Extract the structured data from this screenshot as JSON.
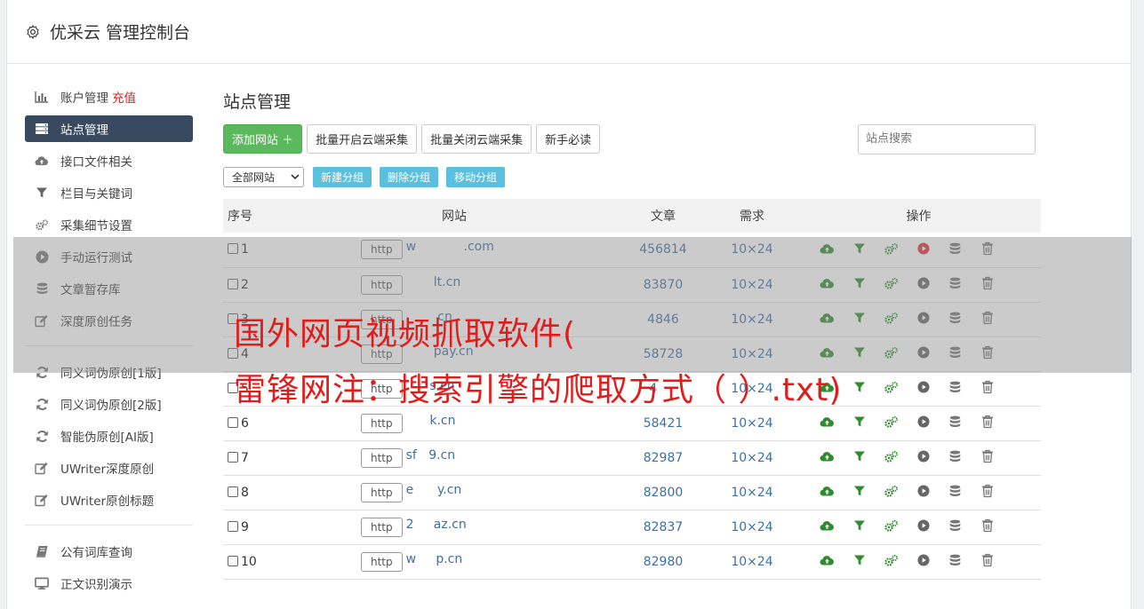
{
  "app": {
    "title": "优采云 管理控制台"
  },
  "sidebar": {
    "items": [
      {
        "label": "账户管理",
        "extra": "充值",
        "icon": "bar-chart-icon"
      },
      {
        "label": "站点管理",
        "icon": "server-icon",
        "active": true
      },
      {
        "label": "接口文件相关",
        "icon": "cloud-upload-icon"
      },
      {
        "label": "栏目与关键词",
        "icon": "filter-icon"
      },
      {
        "label": "采集细节设置",
        "icon": "gears-icon"
      },
      {
        "label": "手动运行测试",
        "icon": "play-circle-icon"
      },
      {
        "label": "文章暂存库",
        "icon": "database-icon"
      },
      {
        "label": "深度原创任务",
        "icon": "edit-icon"
      },
      {
        "label": "同义词伪原创[1版]",
        "icon": "refresh-icon"
      },
      {
        "label": "同义词伪原创[2版]",
        "icon": "refresh-icon"
      },
      {
        "label": "智能伪原创[AI版]",
        "icon": "refresh-icon"
      },
      {
        "label": "UWriter深度原创",
        "icon": "edit-icon"
      },
      {
        "label": "UWriter原创标题",
        "icon": "edit-icon"
      },
      {
        "label": "公有词库查询",
        "icon": "book-icon"
      },
      {
        "label": "正文识别演示",
        "icon": "monitor-icon"
      }
    ]
  },
  "main": {
    "title": "站点管理",
    "toolbar": {
      "add_site": "添加网站 ＋",
      "batch_open": "批量开启云端采集",
      "batch_close": "批量关闭云端采集",
      "newbie": "新手必读",
      "search_placeholder": "站点搜索"
    },
    "filter": {
      "select_value": "全部网站",
      "new_group": "新建分组",
      "delete_group": "删除分组",
      "move_group": "移动分组"
    },
    "table": {
      "headers": {
        "idx": "序号",
        "site": "网站",
        "articles": "文章",
        "demand": "需求",
        "ops": "操作"
      },
      "rows": [
        {
          "idx": "1",
          "prefix": "http",
          "domain": "w            .com",
          "articles": "456814",
          "demand": "10×24",
          "running": true
        },
        {
          "idx": "2",
          "prefix": "http",
          "domain": "       lt.cn",
          "articles": "83870",
          "demand": "10×24",
          "running": false
        },
        {
          "idx": "3",
          "prefix": "http",
          "domain": "        cn",
          "articles": "4846",
          "demand": "10×24",
          "running": false
        },
        {
          "idx": "4",
          "prefix": "http",
          "domain": "       pay.cn",
          "articles": "58728",
          "demand": "10×24",
          "running": false
        },
        {
          "idx": "5",
          "prefix": "http",
          "domain": "      s.cn",
          "articles": "4     ",
          "demand": "10×24",
          "running": false
        },
        {
          "idx": "6",
          "prefix": "http",
          "domain": "      k.cn",
          "articles": "58421",
          "demand": "10×24",
          "running": false
        },
        {
          "idx": "7",
          "prefix": "http",
          "domain": "sf   9.cn",
          "articles": "82987",
          "demand": "10×24",
          "running": false
        },
        {
          "idx": "8",
          "prefix": "http",
          "domain": "e      y.cn",
          "articles": "82800",
          "demand": "10×24",
          "running": false
        },
        {
          "idx": "9",
          "prefix": "http",
          "domain": "2     az.cn",
          "articles": "82837",
          "demand": "10×24",
          "running": false
        },
        {
          "idx": "10",
          "prefix": "http",
          "domain": "w     p.cn",
          "articles": "82980",
          "demand": "10×24",
          "running": false
        }
      ]
    }
  },
  "overlay": {
    "line1": "国外网页视频抓取软件(",
    "line2": "雷锋网注：搜索引擎的爬取方式（  ）.txt)"
  },
  "colors": {
    "active_nav": "#39495f",
    "green_button": "#5cb85c",
    "info_button": "#5bc0de",
    "link_blue": "#3c6fa3",
    "overlay_text": "#e21b1b",
    "recharge": "#e02020",
    "icon_green": "#2e8b2e",
    "run_red": "#e0303a"
  }
}
